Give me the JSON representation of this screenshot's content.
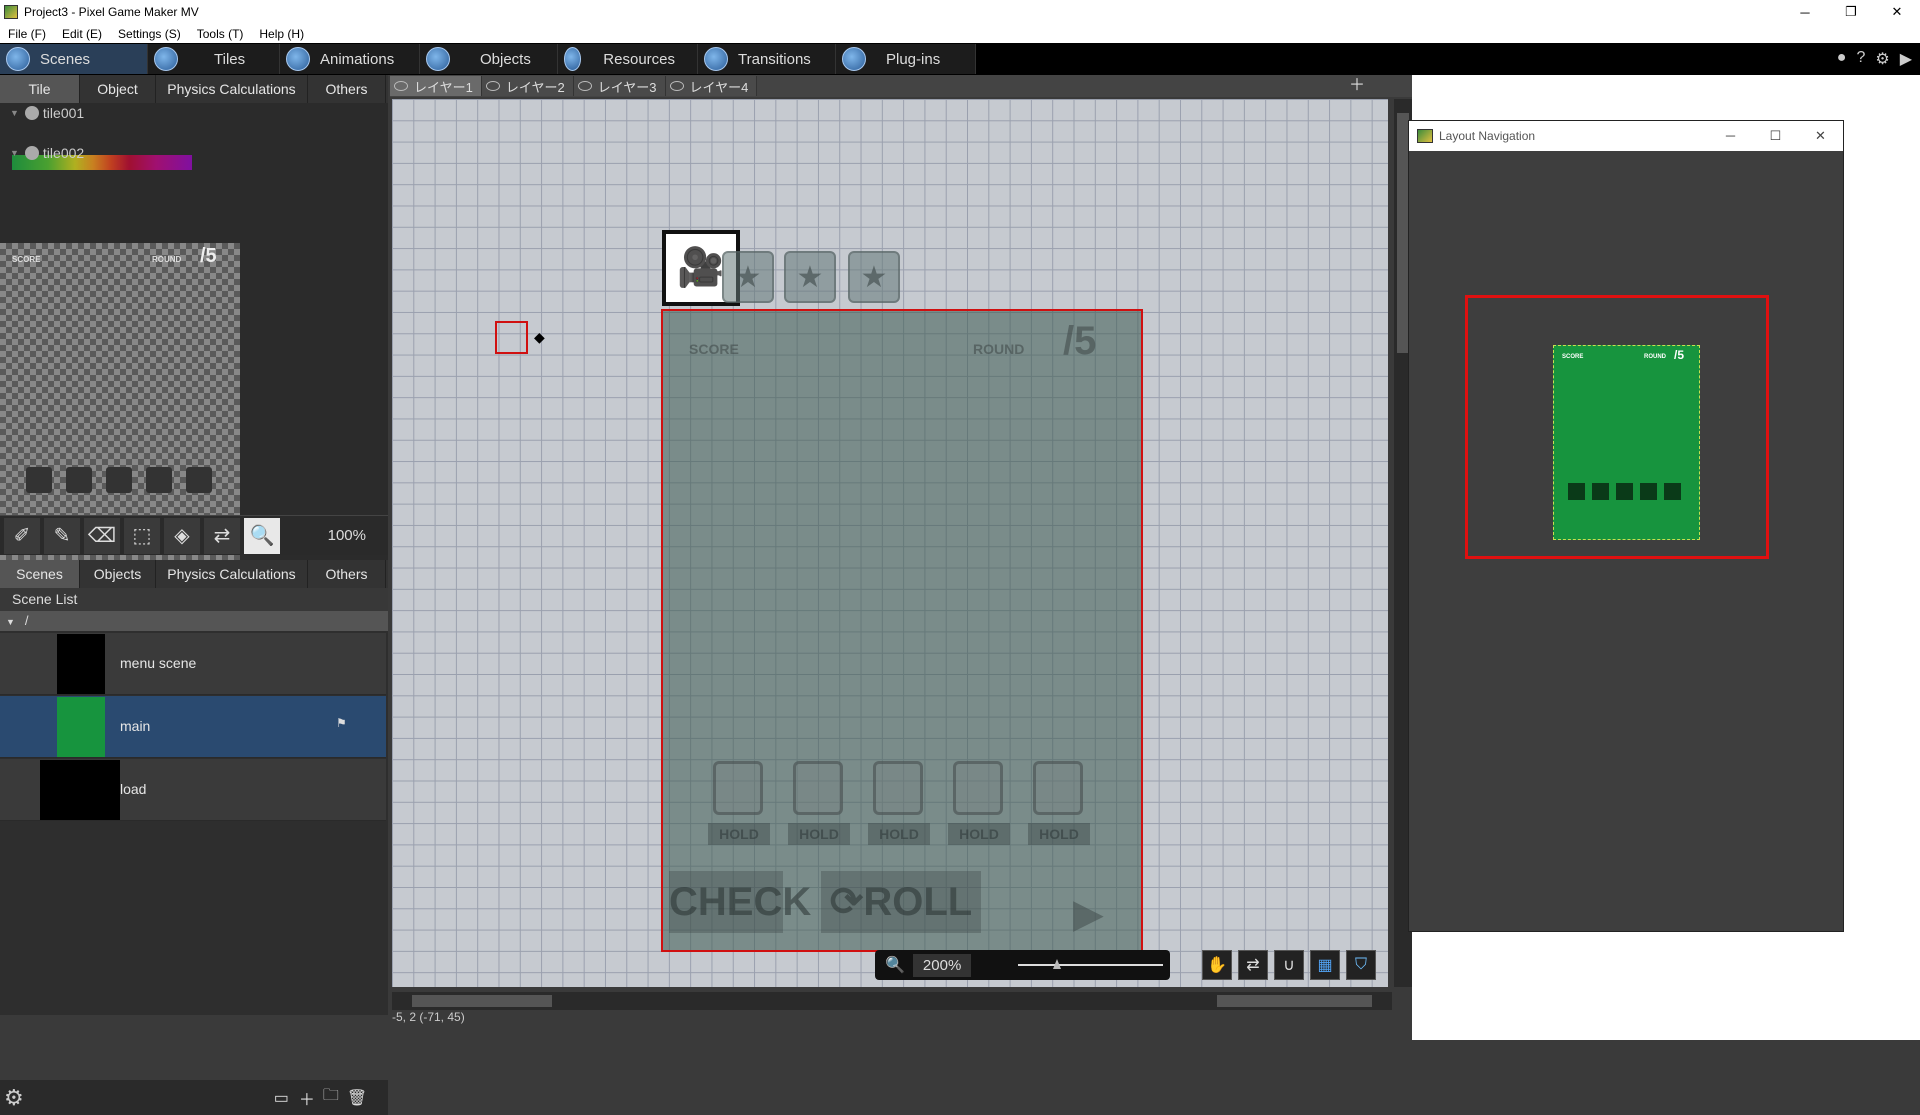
{
  "window": {
    "title": "Project3 - Pixel Game Maker MV",
    "minimize": "─",
    "maximize": "❐",
    "close": "✕"
  },
  "menu": [
    "File (F)",
    "Edit (E)",
    "Settings (S)",
    "Tools (T)",
    "Help (H)"
  ],
  "main_tabs": [
    {
      "label": "Scenes",
      "icon": "scenes-icon",
      "active": true
    },
    {
      "label": "Tiles",
      "icon": "tiles-icon"
    },
    {
      "label": "Animations",
      "icon": "animations-icon"
    },
    {
      "label": "Objects",
      "icon": "objects-icon"
    },
    {
      "label": "Resources",
      "icon": "resources-icon"
    },
    {
      "label": "Transitions",
      "icon": "transitions-icon"
    },
    {
      "label": "Plug-ins",
      "icon": "plugins-icon"
    }
  ],
  "top_subtabs": [
    "Tile",
    "Object",
    "Physics Calculations",
    "Others"
  ],
  "tiles": [
    "tile001",
    "tile002"
  ],
  "tile_preview": {
    "score": "SCORE",
    "round": "ROUND",
    "round_total": "/5"
  },
  "tool_zoom": "100%",
  "bottom_subtabs": [
    "Scenes",
    "Objects",
    "Physics Calculations",
    "Others"
  ],
  "scene_list": {
    "label": "Scene List",
    "root": "/",
    "scenes": [
      {
        "name": "menu scene",
        "selected": false
      },
      {
        "name": "main",
        "selected": true
      },
      {
        "name": "load",
        "selected": false
      }
    ]
  },
  "layers": [
    "レイヤー1",
    "レイヤー2",
    "レイヤー3",
    "レイヤー4"
  ],
  "canvas": {
    "zoom": "200%",
    "score": "SCORE",
    "round": "ROUND",
    "round_total": "/5",
    "hold": "HOLD",
    "check": "CHECK",
    "roll": "⟳ROLL"
  },
  "status": "-5, 2 (-71, 45)",
  "layout_nav": {
    "title": "Layout Navigation",
    "score": "SCORE",
    "round": "ROUND",
    "round_total": "/5"
  },
  "colors": {
    "accent_red": "#d01010",
    "scene_green": "#17943e",
    "selected_row": "#2a4a70"
  }
}
